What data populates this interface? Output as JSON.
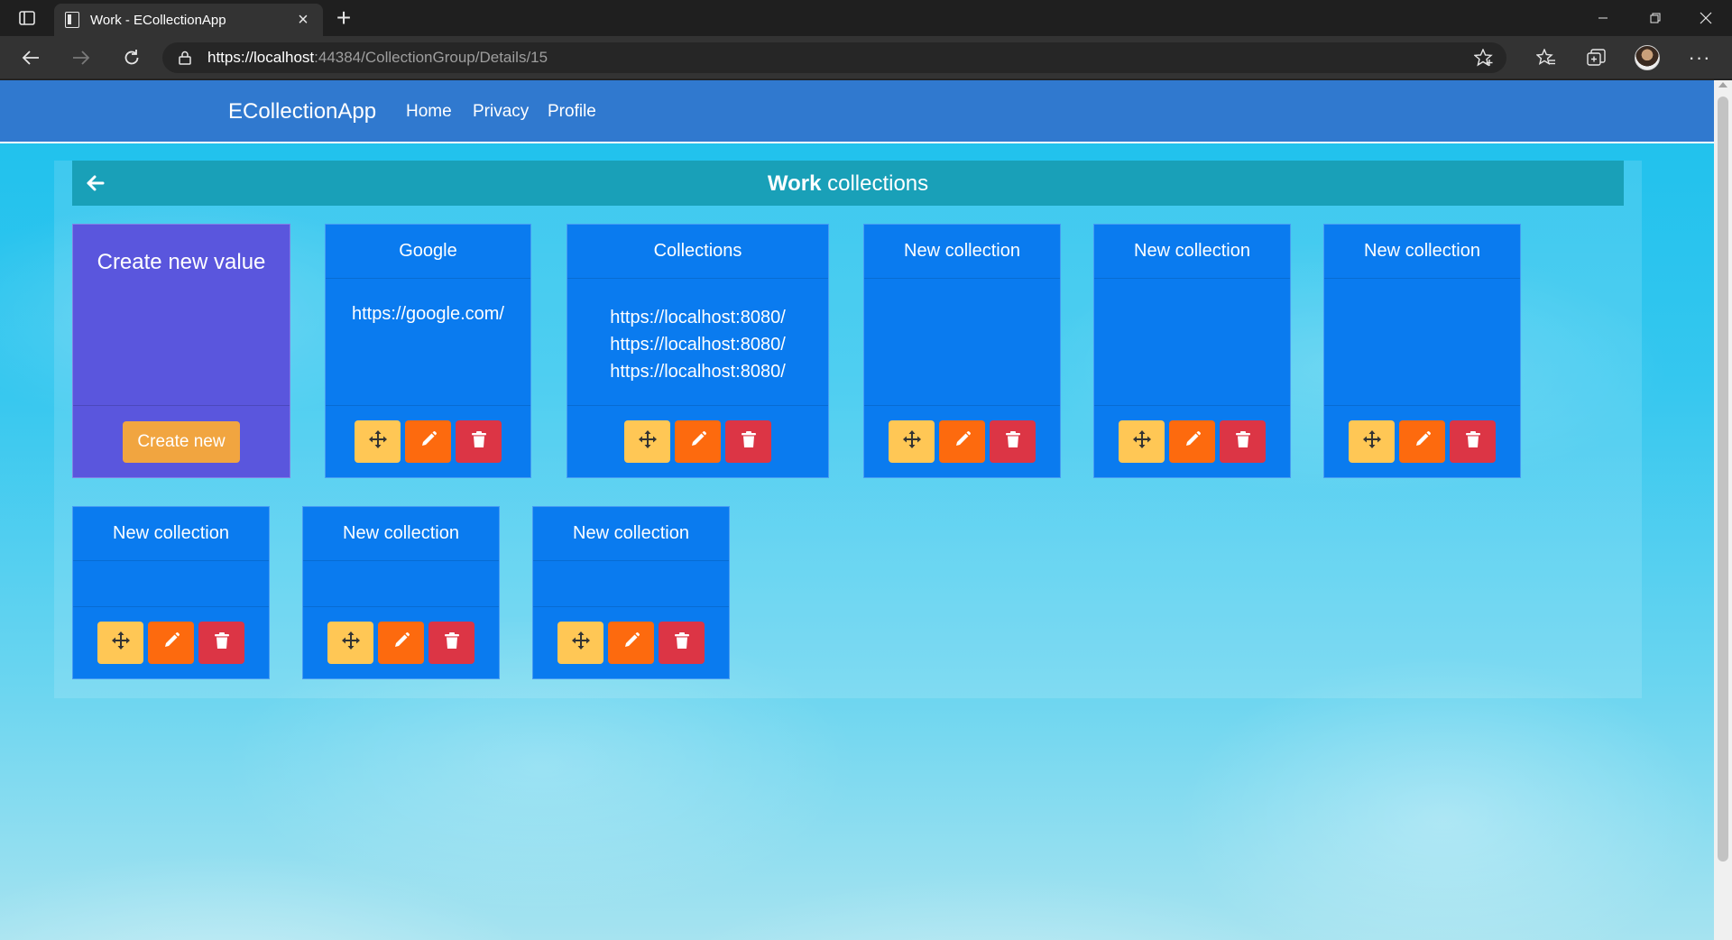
{
  "browser": {
    "tab_title": "Work - ECollectionApp",
    "url_scheme": "https://",
    "url_host": "localhost",
    "url_rest": ":44384/CollectionGroup/Details/15"
  },
  "navbar": {
    "brand": "ECollectionApp",
    "links": [
      "Home",
      "Privacy",
      "Profile"
    ]
  },
  "header": {
    "title_bold": "Work",
    "title_rest": " collections"
  },
  "create_card": {
    "title": "Create new value",
    "button": "Create new"
  },
  "collections": [
    {
      "name": "Google",
      "values": [
        "https://google.com/"
      ]
    },
    {
      "name": "Collections",
      "values": [
        "https://localhost:8080/",
        "https://localhost:8080/",
        "https://localhost:8080/"
      ]
    },
    {
      "name": "New collection",
      "values": []
    },
    {
      "name": "New collection",
      "values": []
    },
    {
      "name": "New collection",
      "values": []
    },
    {
      "name": "New collection",
      "values": []
    },
    {
      "name": "New collection",
      "values": []
    },
    {
      "name": "New collection",
      "values": []
    }
  ],
  "colors": {
    "navbar": "#3079cf",
    "card": "#0a7bef",
    "create_card": "#5a56dd",
    "create_button": "#f1a540",
    "move_button": "#ffc755",
    "edit_button": "#fd6a0e",
    "delete_button": "#dc3545",
    "header_bar": "#19a0b8"
  },
  "icons": {
    "back": "arrow-left-icon",
    "move": "arrows-move-icon",
    "edit": "pencil-icon",
    "delete": "trash-icon"
  }
}
